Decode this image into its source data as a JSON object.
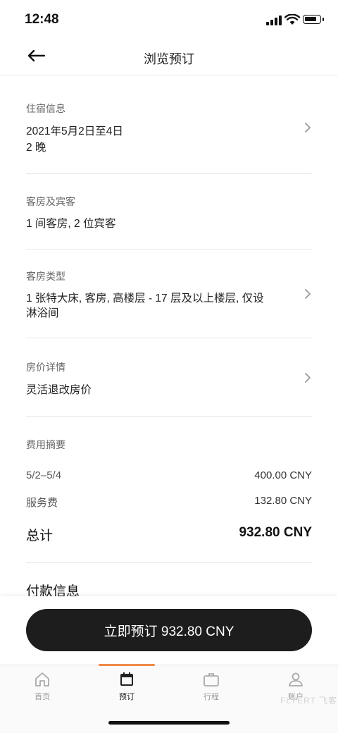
{
  "status_bar": {
    "time": "12:48"
  },
  "header": {
    "title": "浏览预订"
  },
  "stay": {
    "label": "住宿信息",
    "dates": "2021年5月2日至4日",
    "nights": "2 晚"
  },
  "rooms_guests": {
    "label": "客房及宾客",
    "value": "1 间客房, 2 位宾客"
  },
  "room_type": {
    "label": "客房类型",
    "line1": "1 张特大床, 客房, 高楼层 - 17 层及以上楼层, 仅设",
    "line2": "淋浴间"
  },
  "rate": {
    "label": "房价详情",
    "value": "灵活退改房价"
  },
  "summary": {
    "label": "费用摘要",
    "rows": [
      {
        "name": "5/2–5/4",
        "amount": "400.00 CNY"
      },
      {
        "name": "服务费",
        "amount": "132.80 CNY"
      }
    ],
    "total_label": "总计",
    "total_amount": "932.80 CNY"
  },
  "payment": {
    "label": "付款信息"
  },
  "cta": {
    "label": "立即预订 932.80 CNY"
  },
  "tabs": [
    {
      "label": "首页",
      "icon": "home-icon"
    },
    {
      "label": "预订",
      "icon": "calendar-icon"
    },
    {
      "label": "行程",
      "icon": "briefcase-icon"
    },
    {
      "label": "账户",
      "icon": "user-icon"
    }
  ],
  "watermark": "FLYERT 飞客",
  "colors": {
    "accent": "#f08a4b",
    "button": "#1d1d1d"
  }
}
